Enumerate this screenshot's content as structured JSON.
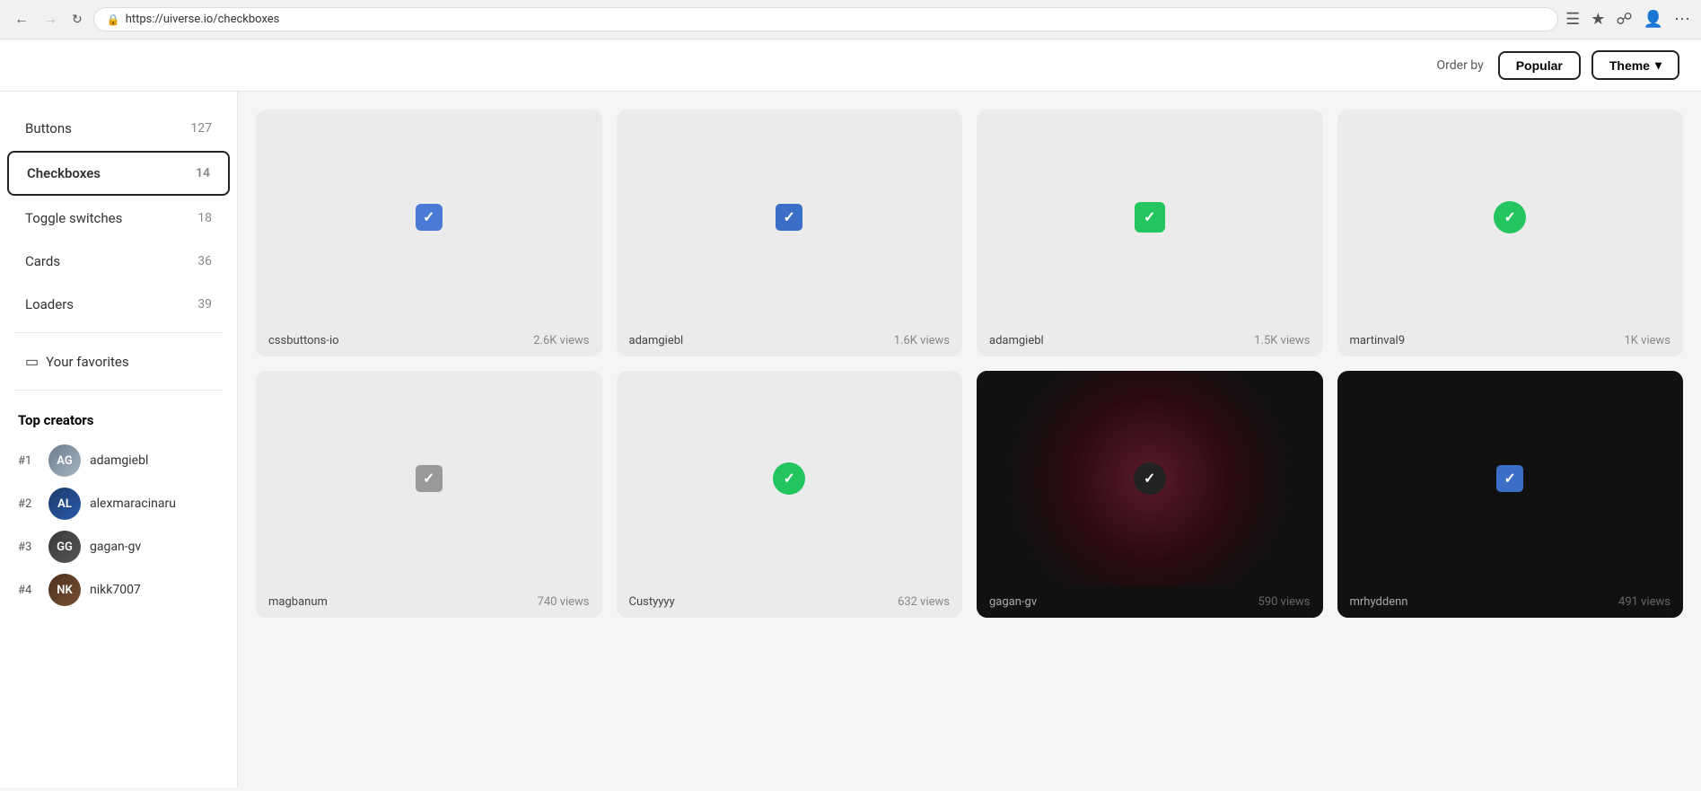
{
  "browser": {
    "url": "https://uiverse.io/checkboxes",
    "back_disabled": false,
    "forward_disabled": true
  },
  "header": {
    "order_label": "Order by",
    "popular_btn": "Popular",
    "theme_btn": "Theme",
    "chevron": "▾"
  },
  "sidebar": {
    "nav_items": [
      {
        "label": "Buttons",
        "count": "127",
        "active": false
      },
      {
        "label": "Checkboxes",
        "count": "14",
        "active": true
      },
      {
        "label": "Toggle switches",
        "count": "18",
        "active": false
      },
      {
        "label": "Cards",
        "count": "36",
        "active": false
      },
      {
        "label": "Loaders",
        "count": "39",
        "active": false
      }
    ],
    "favorites_label": "Your favorites",
    "top_creators_title": "Top creators",
    "creators": [
      {
        "rank": "#1",
        "name": "adamgiebl",
        "initials": "AG"
      },
      {
        "rank": "#2",
        "name": "alexmaracinaru",
        "initials": "AL"
      },
      {
        "rank": "#3",
        "name": "gagan-gv",
        "initials": "GG"
      },
      {
        "rank": "#4",
        "name": "nikk7007",
        "initials": "NK"
      }
    ]
  },
  "cards": [
    {
      "author": "cssbuttons-io",
      "views": "2.6K views",
      "type": "light",
      "checkbox": "blue"
    },
    {
      "author": "adamgiebl",
      "views": "1.6K views",
      "type": "light",
      "checkbox": "blue2"
    },
    {
      "author": "adamgiebl",
      "views": "1.5K views",
      "type": "light",
      "checkbox": "green-rounded"
    },
    {
      "author": "martinval9",
      "views": "1K views",
      "type": "light",
      "checkbox": "green-circle"
    },
    {
      "author": "magbanum",
      "views": "740 views",
      "type": "light",
      "checkbox": "gray"
    },
    {
      "author": "Custyyyy",
      "views": "632 views",
      "type": "light",
      "checkbox": "green-circle"
    },
    {
      "author": "gagan-gv",
      "views": "590 views",
      "type": "dark-glow",
      "checkbox": "black-circle"
    },
    {
      "author": "mrhyddenn",
      "views": "491 views",
      "type": "dark",
      "checkbox": "blue-dark"
    }
  ]
}
